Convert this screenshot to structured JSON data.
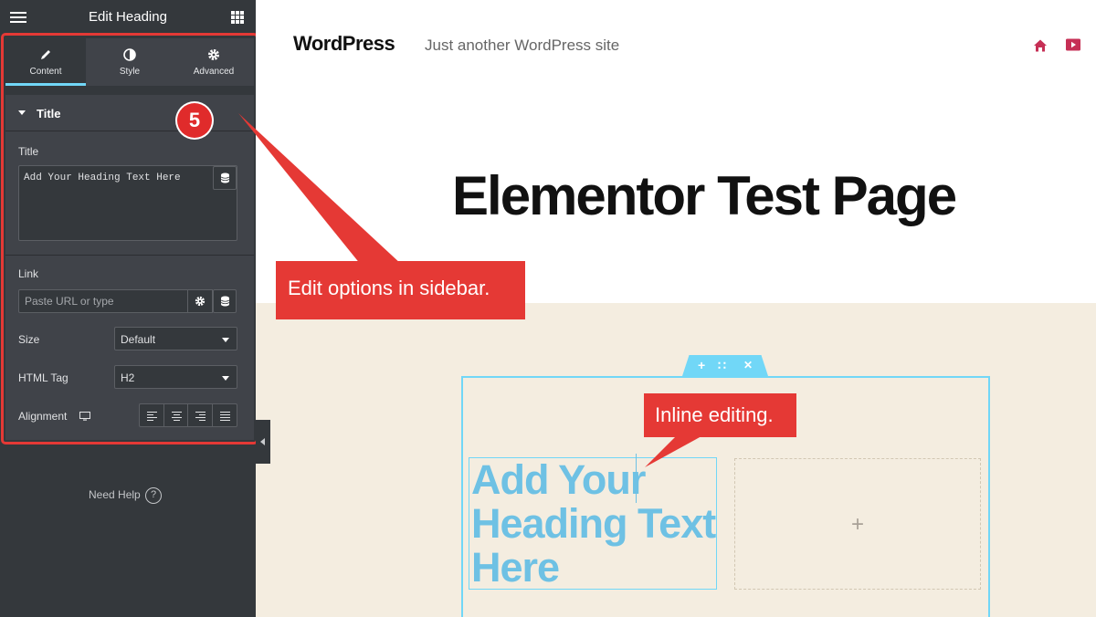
{
  "sidebar": {
    "header_title": "Edit Heading",
    "tabs": [
      {
        "label": "Content",
        "icon": "pencil-icon"
      },
      {
        "label": "Style",
        "icon": "contrast-icon"
      },
      {
        "label": "Advanced",
        "icon": "gear-icon"
      }
    ],
    "section_title": "Title",
    "step_badge": "5",
    "title_label": "Title",
    "title_value": "Add Your Heading Text Here",
    "link_label": "Link",
    "link_placeholder": "Paste URL or type",
    "size_label": "Size",
    "size_value": "Default",
    "html_tag_label": "HTML Tag",
    "html_tag_value": "H2",
    "alignment_label": "Alignment",
    "need_help": "Need Help",
    "help_glyph": "?"
  },
  "site": {
    "name": "WordPress",
    "tagline": "Just another WordPress site",
    "page_title": "Elementor Test Page"
  },
  "canvas": {
    "heading_text": "Add Your Heading Text Here",
    "add_widget_glyph": "+",
    "section_controls": [
      "+",
      "∷",
      "✕"
    ]
  },
  "callouts": {
    "sidebar_note": "Edit options in sidebar.",
    "inline_note": "Inline editing."
  },
  "colors": {
    "sidebar_bg": "#34383c",
    "accent_blue": "#71d7f7",
    "heading_blue": "#6ec1e4",
    "callout_red": "#e53935",
    "section_beige": "#f4ede0",
    "icon_crimson": "#c62f55"
  }
}
